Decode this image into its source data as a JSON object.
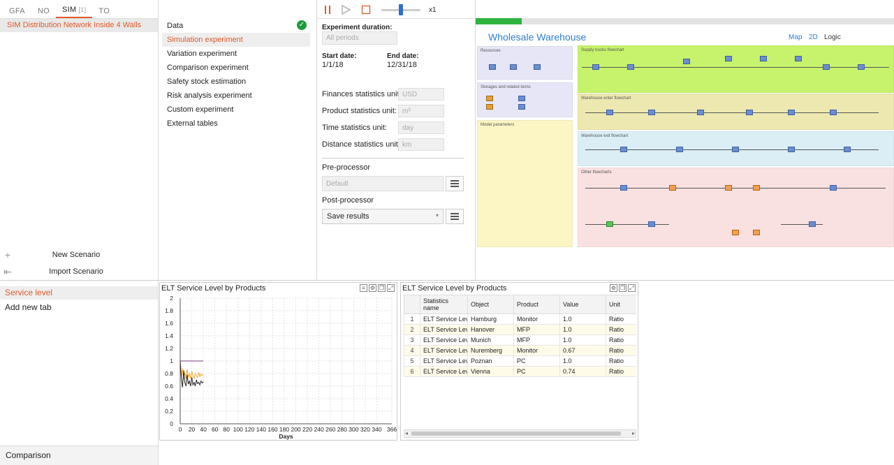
{
  "top_tabs": [
    {
      "label": "GFA"
    },
    {
      "label": "NO"
    },
    {
      "label": "SIM",
      "sub": "[1]"
    },
    {
      "label": "TO"
    }
  ],
  "scenario": "SIM Distribution Network Inside 4 Walls",
  "side_actions": {
    "new": "New Scenario",
    "import": "Import Scenario"
  },
  "experiments": [
    "Data",
    "Simulation experiment",
    "Variation experiment",
    "Comparison experiment",
    "Safety stock estimation",
    "Risk analysis experiment",
    "Custom experiment",
    "External tables"
  ],
  "toolbar": {
    "speed": "x1"
  },
  "settings": {
    "duration_label": "Experiment duration:",
    "duration_value": "All periods",
    "start_label": "Start date:",
    "start_value": "1/1/18",
    "end_label": "End date:",
    "end_value": "12/31/18",
    "units": [
      {
        "label": "Finances statistics unit:",
        "value": "USD"
      },
      {
        "label": "Product statistics unit:",
        "value": "m³"
      },
      {
        "label": "Time statistics unit:",
        "value": "day"
      },
      {
        "label": "Distance statistics unit:",
        "value": "km"
      }
    ],
    "pre_label": "Pre-processor",
    "pre_value": "Default",
    "post_label": "Post-processor",
    "post_value": "Save results"
  },
  "warehouse": {
    "title": "Wholesale Warehouse",
    "view_links": [
      "Map",
      "2D",
      "Logic"
    ],
    "sections": [
      "Resources",
      "Storages and related items",
      "Model parameters",
      "Supply trucks flowchart",
      "Warehouse enter flowchart",
      "Warehouse exit flowchart",
      "Other flowcharts"
    ],
    "colors": {
      "supply": "#c7f26b",
      "enter": "#ece8b0",
      "exit": "#dbeef5",
      "other": "#fae1e1",
      "left": "#e6e6f7",
      "params": "#fbf6c4"
    }
  },
  "stats_tabs": [
    {
      "label": "Service level",
      "active": true
    },
    {
      "label": "Add new tab"
    }
  ],
  "comparison": "Comparison",
  "chart_panel_title": "ELT Service Level by Products",
  "chart_data": {
    "type": "line",
    "xlabel": "Days",
    "ylabel": "",
    "xlim": [
      0,
      366
    ],
    "ylim": [
      0,
      2
    ],
    "x_ticks": [
      0,
      20,
      40,
      60,
      80,
      100,
      120,
      140,
      160,
      180,
      200,
      220,
      240,
      260,
      280,
      300,
      320,
      340,
      366
    ],
    "y_ticks": [
      0,
      0.2,
      0.4,
      0.6,
      0.8,
      1,
      1.2,
      1.4,
      1.6,
      1.8,
      2
    ],
    "y_tick_labels": [
      "0",
      "0.2",
      "0.4",
      "0.6",
      "0.8",
      "1",
      "1.2",
      "1.4",
      "1.6",
      "1.8",
      "2"
    ],
    "series": [
      {
        "color": "#7b3b7b",
        "x": [
          0,
          1,
          2,
          4,
          40
        ],
        "y": [
          1,
          1,
          1,
          1,
          1
        ]
      },
      {
        "color": "#f2a72a",
        "x": [
          0,
          2,
          4,
          6,
          8,
          10,
          12,
          14,
          16,
          18,
          20,
          22,
          24,
          26,
          28,
          30,
          32,
          34,
          36,
          38,
          40
        ],
        "y": [
          1,
          0.75,
          0.88,
          0.7,
          0.82,
          0.72,
          0.86,
          0.74,
          0.8,
          0.72,
          0.84,
          0.76,
          0.72,
          0.8,
          0.76,
          0.74,
          0.82,
          0.75,
          0.79,
          0.77,
          0.78
        ]
      },
      {
        "color": "#222222",
        "x": [
          0,
          2,
          4,
          6,
          8,
          10,
          12,
          14,
          16,
          18,
          20,
          22,
          24,
          26,
          28,
          30,
          32,
          34,
          36,
          38,
          40
        ],
        "y": [
          1,
          0.72,
          0.58,
          0.85,
          0.66,
          0.6,
          0.78,
          0.63,
          0.68,
          0.6,
          0.74,
          0.62,
          0.66,
          0.6,
          0.7,
          0.64,
          0.66,
          0.62,
          0.68,
          0.65,
          0.67
        ]
      }
    ]
  },
  "table_panel_title": "ELT Service Level by Products",
  "table": {
    "columns": [
      "",
      "Statistics name",
      "Object",
      "Product",
      "Value",
      "Unit"
    ],
    "rows": [
      [
        "1",
        "ELT Service Lev...",
        "Hamburg",
        "Monitor",
        "1.0",
        "Ratio"
      ],
      [
        "2",
        "ELT Service Lev...",
        "Hanover",
        "MFP",
        "1.0",
        "Ratio"
      ],
      [
        "3",
        "ELT Service Lev...",
        "Munich",
        "MFP",
        "1.0",
        "Ratio"
      ],
      [
        "4",
        "ELT Service Lev...",
        "Nuremberg",
        "Monitor",
        "0.67",
        "Ratio"
      ],
      [
        "5",
        "ELT Service Lev...",
        "Poznan",
        "PC",
        "1.0",
        "Ratio"
      ],
      [
        "6",
        "ELT Service Lev...",
        "Vienna",
        "PC",
        "0.74",
        "Ratio"
      ]
    ]
  }
}
